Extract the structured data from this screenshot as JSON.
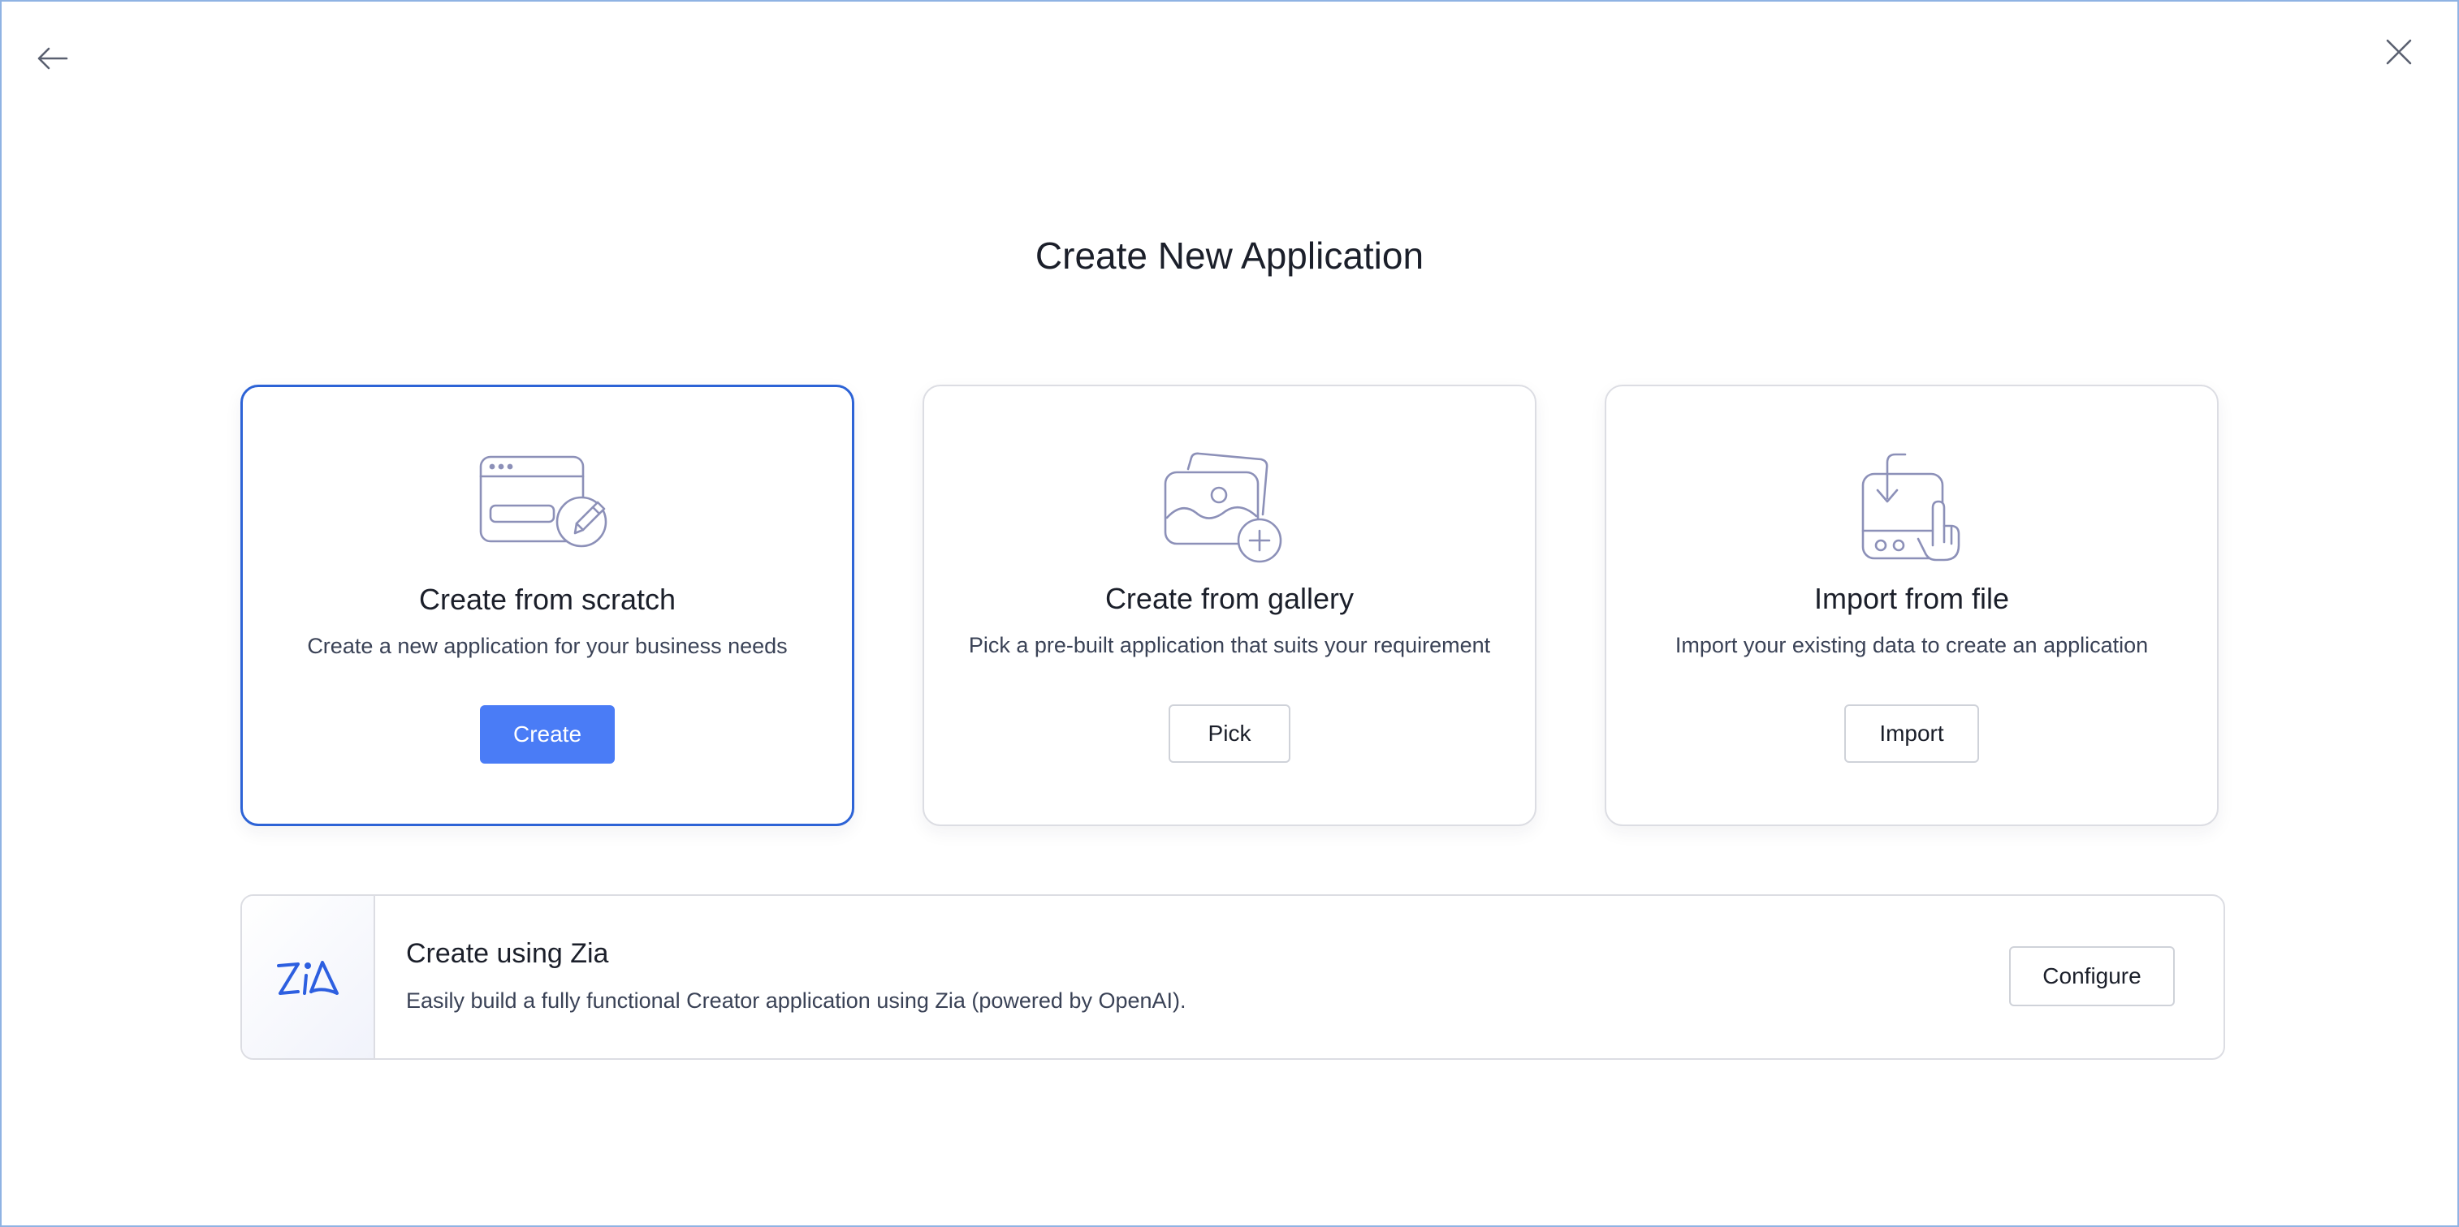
{
  "header": {
    "title": "Create New Application",
    "back_icon": "arrow-left-icon",
    "close_icon": "close-icon"
  },
  "cards": [
    {
      "title": "Create from scratch",
      "description": "Create a new application for your business needs",
      "button_label": "Create",
      "icon": "browser-window-pencil-icon",
      "selected": true
    },
    {
      "title": "Create from gallery",
      "description": "Pick a pre-built application that suits your requirement",
      "button_label": "Pick",
      "icon": "image-gallery-plus-icon",
      "selected": false
    },
    {
      "title": "Import from file",
      "description": "Import your existing data to create an application",
      "button_label": "Import",
      "icon": "file-import-hand-icon",
      "selected": false
    }
  ],
  "zia": {
    "title": "Create using Zia",
    "description": "Easily build a fully functional Creator application using Zia (powered by OpenAI).",
    "button_label": "Configure",
    "icon": "zia-logo-icon"
  },
  "colors": {
    "accent": "#4a7cf6",
    "selected_border": "#2d63d6",
    "illustration_stroke": "#8c90b8",
    "zia_logo": "#2d5fe0",
    "frame_border": "#8fb3e3"
  }
}
